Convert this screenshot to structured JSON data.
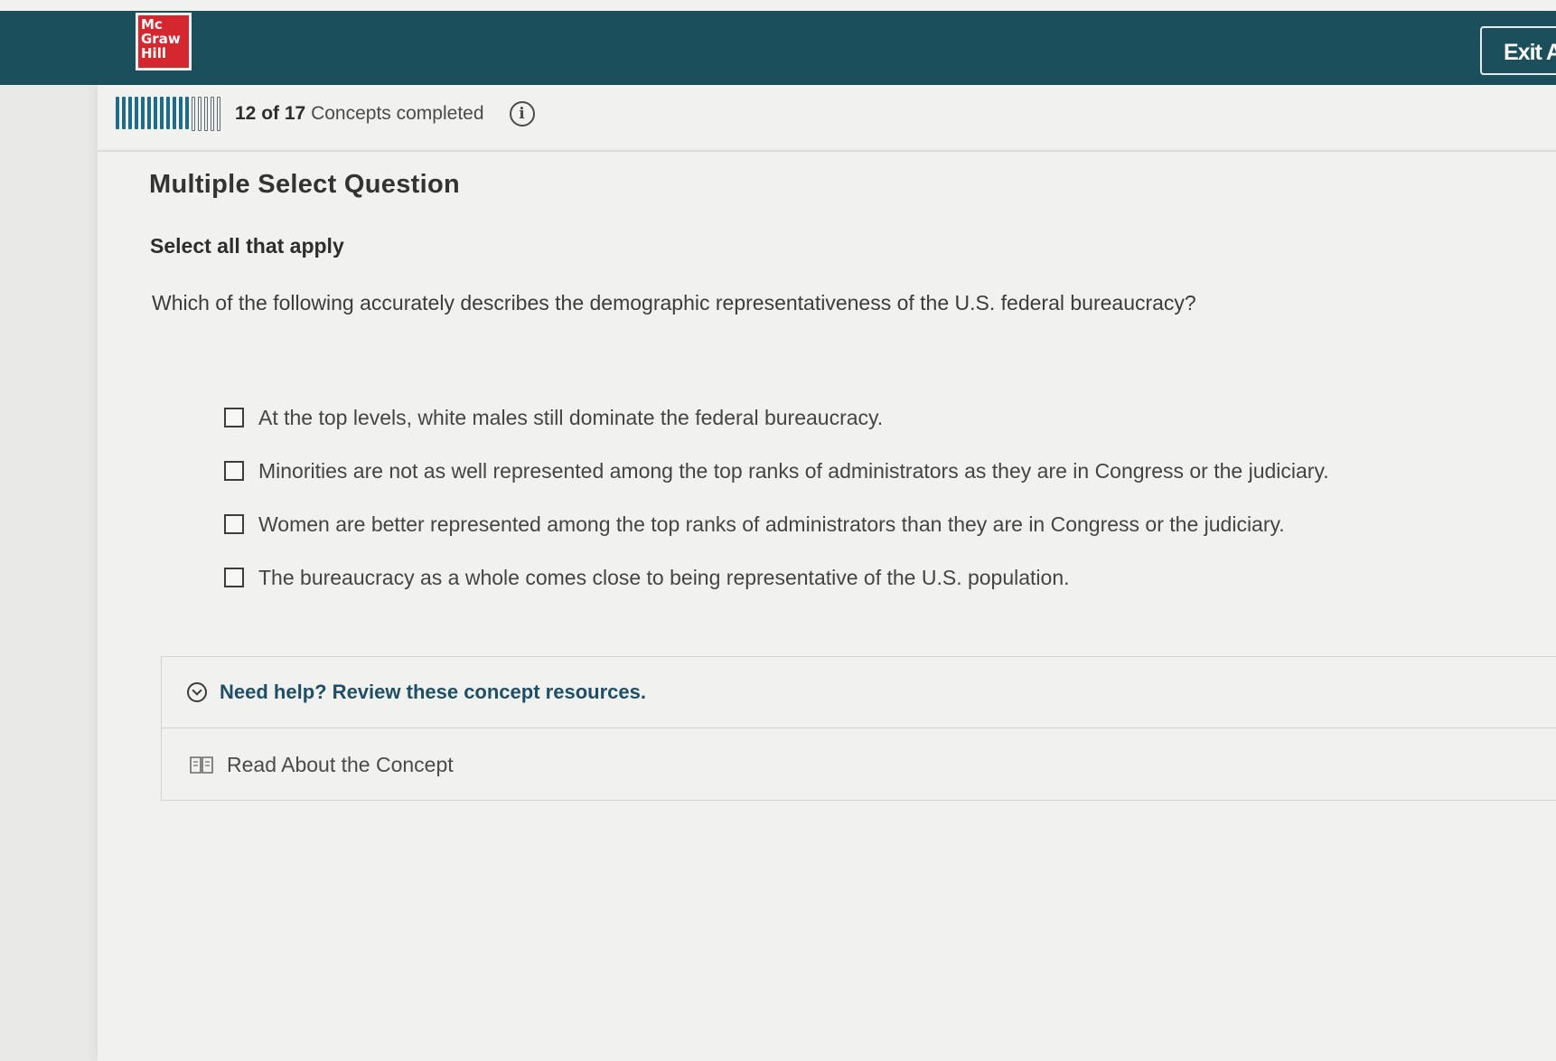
{
  "header": {
    "logo_lines": [
      "Mc",
      "Graw",
      "Hill"
    ],
    "exit_label": "Exit A",
    "accent_color": "#1b4f5b",
    "logo_color": "#d4272f"
  },
  "progress": {
    "completed": "12",
    "of_label": "of",
    "total": "17",
    "suffix": "Concepts completed",
    "info_icon": "info-icon"
  },
  "question": {
    "type_label": "Multiple Select Question",
    "instruction": "Select all that apply",
    "prompt": "Which of the following accurately describes the demographic representativeness of the U.S. federal bureaucracy?",
    "options": [
      {
        "label": "At the top levels, white males still dominate the federal bureaucracy.",
        "checked": false
      },
      {
        "label": "Minorities are not as well represented among the top ranks of administrators as they are in Congress or the judiciary.",
        "checked": false
      },
      {
        "label": "Women are better represented among the top ranks of administrators than they are in Congress or the judiciary.",
        "checked": false
      },
      {
        "label": "The bureaucracy as a whole comes close to being representative of the U.S. population.",
        "checked": false
      }
    ]
  },
  "help": {
    "title": "Need help? Review these concept resources.",
    "read_label": "Read About the Concept",
    "icons": [
      "chevron-down-icon",
      "book-icon"
    ]
  }
}
